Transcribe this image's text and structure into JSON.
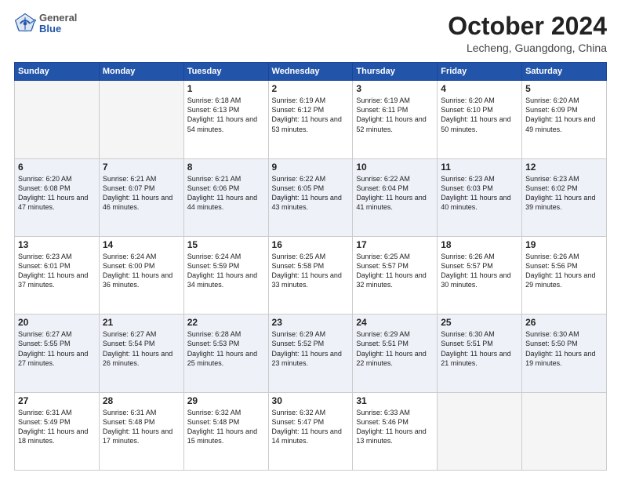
{
  "header": {
    "logo_general": "General",
    "logo_blue": "Blue",
    "month_title": "October 2024",
    "location": "Lecheng, Guangdong, China"
  },
  "days_of_week": [
    "Sunday",
    "Monday",
    "Tuesday",
    "Wednesday",
    "Thursday",
    "Friday",
    "Saturday"
  ],
  "weeks": [
    [
      {
        "day": "",
        "empty": true
      },
      {
        "day": "",
        "empty": true
      },
      {
        "day": "1",
        "sunrise": "6:18 AM",
        "sunset": "6:13 PM",
        "daylight": "11 hours and 54 minutes."
      },
      {
        "day": "2",
        "sunrise": "6:19 AM",
        "sunset": "6:12 PM",
        "daylight": "11 hours and 53 minutes."
      },
      {
        "day": "3",
        "sunrise": "6:19 AM",
        "sunset": "6:11 PM",
        "daylight": "11 hours and 52 minutes."
      },
      {
        "day": "4",
        "sunrise": "6:20 AM",
        "sunset": "6:10 PM",
        "daylight": "11 hours and 50 minutes."
      },
      {
        "day": "5",
        "sunrise": "6:20 AM",
        "sunset": "6:09 PM",
        "daylight": "11 hours and 49 minutes."
      }
    ],
    [
      {
        "day": "6",
        "sunrise": "6:20 AM",
        "sunset": "6:08 PM",
        "daylight": "11 hours and 47 minutes."
      },
      {
        "day": "7",
        "sunrise": "6:21 AM",
        "sunset": "6:07 PM",
        "daylight": "11 hours and 46 minutes."
      },
      {
        "day": "8",
        "sunrise": "6:21 AM",
        "sunset": "6:06 PM",
        "daylight": "11 hours and 44 minutes."
      },
      {
        "day": "9",
        "sunrise": "6:22 AM",
        "sunset": "6:05 PM",
        "daylight": "11 hours and 43 minutes."
      },
      {
        "day": "10",
        "sunrise": "6:22 AM",
        "sunset": "6:04 PM",
        "daylight": "11 hours and 41 minutes."
      },
      {
        "day": "11",
        "sunrise": "6:23 AM",
        "sunset": "6:03 PM",
        "daylight": "11 hours and 40 minutes."
      },
      {
        "day": "12",
        "sunrise": "6:23 AM",
        "sunset": "6:02 PM",
        "daylight": "11 hours and 39 minutes."
      }
    ],
    [
      {
        "day": "13",
        "sunrise": "6:23 AM",
        "sunset": "6:01 PM",
        "daylight": "11 hours and 37 minutes."
      },
      {
        "day": "14",
        "sunrise": "6:24 AM",
        "sunset": "6:00 PM",
        "daylight": "11 hours and 36 minutes."
      },
      {
        "day": "15",
        "sunrise": "6:24 AM",
        "sunset": "5:59 PM",
        "daylight": "11 hours and 34 minutes."
      },
      {
        "day": "16",
        "sunrise": "6:25 AM",
        "sunset": "5:58 PM",
        "daylight": "11 hours and 33 minutes."
      },
      {
        "day": "17",
        "sunrise": "6:25 AM",
        "sunset": "5:57 PM",
        "daylight": "11 hours and 32 minutes."
      },
      {
        "day": "18",
        "sunrise": "6:26 AM",
        "sunset": "5:57 PM",
        "daylight": "11 hours and 30 minutes."
      },
      {
        "day": "19",
        "sunrise": "6:26 AM",
        "sunset": "5:56 PM",
        "daylight": "11 hours and 29 minutes."
      }
    ],
    [
      {
        "day": "20",
        "sunrise": "6:27 AM",
        "sunset": "5:55 PM",
        "daylight": "11 hours and 27 minutes."
      },
      {
        "day": "21",
        "sunrise": "6:27 AM",
        "sunset": "5:54 PM",
        "daylight": "11 hours and 26 minutes."
      },
      {
        "day": "22",
        "sunrise": "6:28 AM",
        "sunset": "5:53 PM",
        "daylight": "11 hours and 25 minutes."
      },
      {
        "day": "23",
        "sunrise": "6:29 AM",
        "sunset": "5:52 PM",
        "daylight": "11 hours and 23 minutes."
      },
      {
        "day": "24",
        "sunrise": "6:29 AM",
        "sunset": "5:51 PM",
        "daylight": "11 hours and 22 minutes."
      },
      {
        "day": "25",
        "sunrise": "6:30 AM",
        "sunset": "5:51 PM",
        "daylight": "11 hours and 21 minutes."
      },
      {
        "day": "26",
        "sunrise": "6:30 AM",
        "sunset": "5:50 PM",
        "daylight": "11 hours and 19 minutes."
      }
    ],
    [
      {
        "day": "27",
        "sunrise": "6:31 AM",
        "sunset": "5:49 PM",
        "daylight": "11 hours and 18 minutes."
      },
      {
        "day": "28",
        "sunrise": "6:31 AM",
        "sunset": "5:48 PM",
        "daylight": "11 hours and 17 minutes."
      },
      {
        "day": "29",
        "sunrise": "6:32 AM",
        "sunset": "5:48 PM",
        "daylight": "11 hours and 15 minutes."
      },
      {
        "day": "30",
        "sunrise": "6:32 AM",
        "sunset": "5:47 PM",
        "daylight": "11 hours and 14 minutes."
      },
      {
        "day": "31",
        "sunrise": "6:33 AM",
        "sunset": "5:46 PM",
        "daylight": "11 hours and 13 minutes."
      },
      {
        "day": "",
        "empty": true
      },
      {
        "day": "",
        "empty": true
      }
    ]
  ]
}
